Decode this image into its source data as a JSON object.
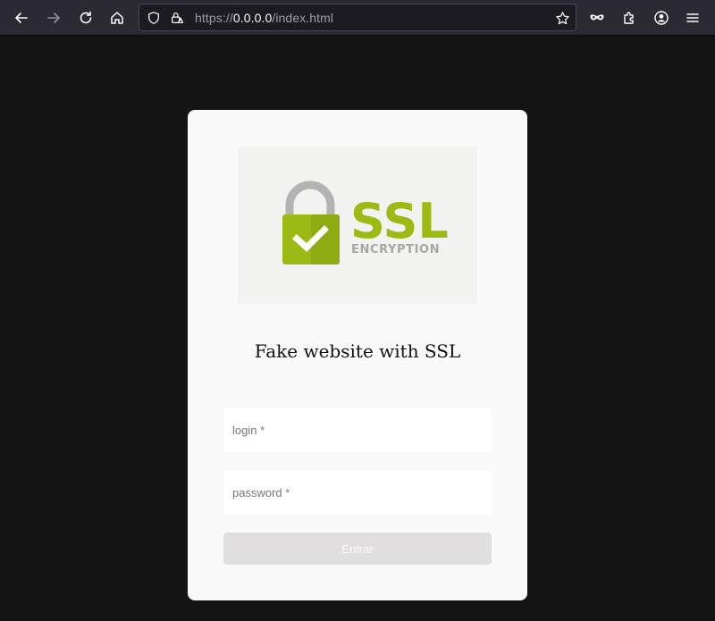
{
  "browser": {
    "url_scheme": "https://",
    "url_host": "0.0.0.0",
    "url_path": "/index.html"
  },
  "page": {
    "title": "Fake website with SSL",
    "logo": {
      "main": "SSL",
      "sub": "ENCRYPTION"
    },
    "login_placeholder": "login *",
    "password_placeholder": "password *",
    "submit_label": "Entrar"
  },
  "colors": {
    "page_bg": "#141414",
    "card_bg": "#f9f9f9",
    "ssl_green": "#9bbb14",
    "lock_grey": "#b3b3b3",
    "button_bg": "#e0dede"
  }
}
